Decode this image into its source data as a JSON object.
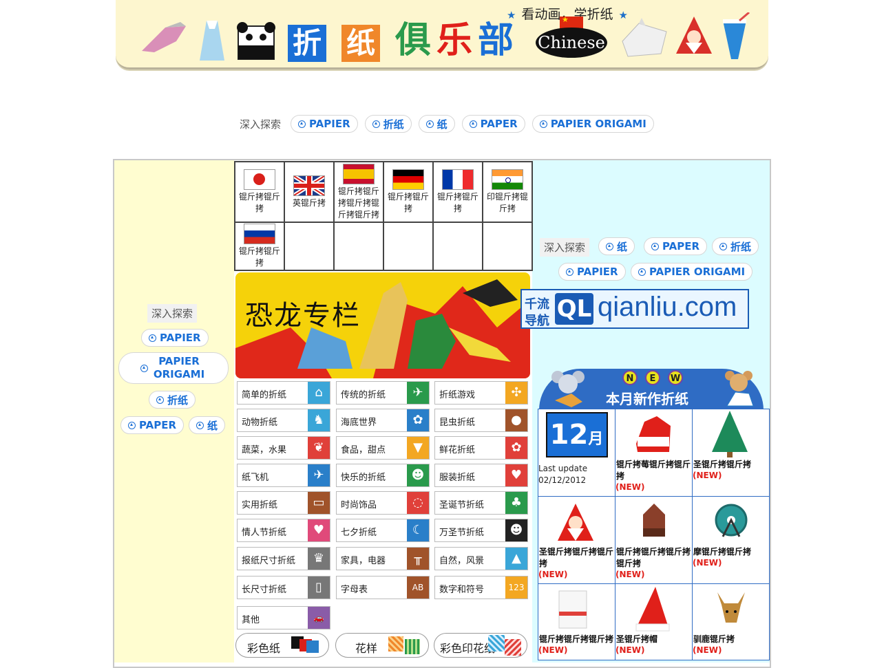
{
  "header": {
    "tagline": "看动画，学折纸",
    "title_chars": [
      "折",
      "纸",
      "俱",
      "乐",
      "部"
    ],
    "badge": "Chinese"
  },
  "search_top": {
    "label": "深入探索",
    "chips": [
      "PAPIER",
      "折纸",
      "纸",
      "PAPER",
      "PAPIER ORIGAMI"
    ]
  },
  "search_left": {
    "label": "深入探索",
    "chips": [
      "PAPIER",
      "PAPIER ORIGAMI",
      "折纸",
      "PAPER",
      "纸"
    ]
  },
  "search_right": {
    "label": "深入探索",
    "chips": [
      "纸",
      "PAPER",
      "折纸",
      "PAPIER",
      "PAPIER ORIGAMI"
    ]
  },
  "languages": [
    {
      "label": "锟斤拷锟斤拷",
      "flag": "jp"
    },
    {
      "label": "英锟斤拷",
      "flag": "gb"
    },
    {
      "label": "锟斤拷锟斤拷锟斤拷锟斤拷锟斤拷",
      "flag": "es"
    },
    {
      "label": "锟斤拷锟斤拷",
      "flag": "de"
    },
    {
      "label": "锟斤拷锟斤拷",
      "flag": "fr"
    },
    {
      "label": "印锟斤拷锟斤拷",
      "flag": "in"
    },
    {
      "label": "锟斤拷锟斤拷",
      "flag": "ru"
    }
  ],
  "dino_banner": {
    "title": "恐龙专栏"
  },
  "categories": [
    {
      "label": "简单的折纸",
      "icon": "house-icon",
      "color": "#3aa6d8",
      "glyph": "⌂"
    },
    {
      "label": "传统的折纸",
      "icon": "crane-icon",
      "color": "#2a9a4c",
      "glyph": "✈"
    },
    {
      "label": "折纸游戏",
      "icon": "pinwheel-icon",
      "color": "#f3a722",
      "glyph": "✣"
    },
    {
      "label": "动物折纸",
      "icon": "giraffe-icon",
      "color": "#3aa6d8",
      "glyph": "♞"
    },
    {
      "label": "海底世界",
      "icon": "fish-icon",
      "color": "#2a7fc9",
      "glyph": "✿"
    },
    {
      "label": "昆虫折纸",
      "icon": "ladybug-icon",
      "color": "#a0532a",
      "glyph": "●"
    },
    {
      "label": "蔬菜，水果",
      "icon": "strawberry-icon",
      "color": "#e0403a",
      "glyph": "❦"
    },
    {
      "label": "食品，甜点",
      "icon": "icecream-icon",
      "color": "#f3a722",
      "glyph": "▼"
    },
    {
      "label": "鲜花折纸",
      "icon": "flower-icon",
      "color": "#e0403a",
      "glyph": "✿"
    },
    {
      "label": "纸飞机",
      "icon": "airplane-icon",
      "color": "#2a7fc9",
      "glyph": "✈"
    },
    {
      "label": "快乐的折纸",
      "icon": "hat-icon",
      "color": "#2a9a4c",
      "glyph": "☻"
    },
    {
      "label": "服装折纸",
      "icon": "shirt-icon",
      "color": "#e0403a",
      "glyph": "♥"
    },
    {
      "label": "实用折纸",
      "icon": "wallet-icon",
      "color": "#a0532a",
      "glyph": "▭"
    },
    {
      "label": "时尚饰品",
      "icon": "necklace-icon",
      "color": "#e0403a",
      "glyph": "◌"
    },
    {
      "label": "圣诞节折纸",
      "icon": "christmas-tree-icon",
      "color": "#2a9a4c",
      "glyph": "♣"
    },
    {
      "label": "情人节折纸",
      "icon": "heart-icon",
      "color": "#e04a7a",
      "glyph": "♥"
    },
    {
      "label": "七夕折纸",
      "icon": "tanabata-icon",
      "color": "#2a7fc9",
      "glyph": "☾"
    },
    {
      "label": "万圣节折纸",
      "icon": "pumpkin-icon",
      "color": "#222222",
      "glyph": "☻"
    },
    {
      "label": "报纸尺寸折纸",
      "icon": "crown-icon",
      "color": "#777777",
      "glyph": "♛"
    },
    {
      "label": "家具，电器",
      "icon": "table-icon",
      "color": "#a0532a",
      "glyph": "╥"
    },
    {
      "label": "自然，风景",
      "icon": "mountain-icon",
      "color": "#3aa6d8",
      "glyph": "▲"
    },
    {
      "label": "长尺寸折纸",
      "icon": "rectangle-icon",
      "color": "#777777",
      "glyph": "▯"
    },
    {
      "label": "字母表",
      "icon": "alphabet-icon",
      "color": "#a0532a",
      "glyph": "AB"
    },
    {
      "label": "数字和符号",
      "icon": "numbers-icon",
      "color": "#f3a722",
      "glyph": "123"
    },
    {
      "label": "其他",
      "icon": "car-icon",
      "color": "#8a5ca8",
      "glyph": "🚗"
    }
  ],
  "paper_buttons": [
    "彩色纸",
    "花样",
    "彩色印花纸"
  ],
  "qianliu": {
    "prefix_top": "千流",
    "prefix_bottom": "导航",
    "logo": "QL",
    "domain": "qianliu.com"
  },
  "new_works": {
    "letters": [
      "N",
      "E",
      "W"
    ],
    "title": "本月新作折纸",
    "month_number": "12",
    "month_unit": "月",
    "update_label": "Last update",
    "update_date": "02/12/2012",
    "new_tag": "(NEW)",
    "items": [
      {
        "title": "锟斤拷莓锟斤拷锟斤拷"
      },
      {
        "title": "圣锟斤拷锟斤拷"
      },
      {
        "title": "圣锟斤拷锟斤拷锟斤拷"
      },
      {
        "title": "锟斤拷锟斤拷锟斤拷锟斤拷"
      },
      {
        "title": "摩锟斤拷锟斤拷"
      },
      {
        "title": "锟斤拷锟斤拷锟斤拷"
      },
      {
        "title": "圣锟斤拷帽"
      },
      {
        "title": "驯鹿锟斤拷"
      }
    ]
  }
}
